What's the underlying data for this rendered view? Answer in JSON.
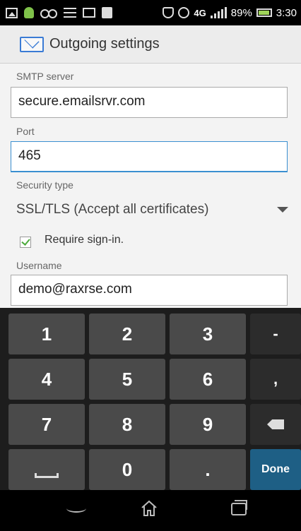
{
  "status_bar": {
    "battery": "89%",
    "time": "3:30",
    "icons": [
      "picture-icon",
      "android-icon",
      "voicemail-icon",
      "menu-lines-icon",
      "mail-icon",
      "shopping-bag-icon",
      "shield-icon",
      "clock-icon",
      "antenna-icon",
      "signal-icon",
      "battery-icon"
    ]
  },
  "action_bar": {
    "title": "Outgoing settings",
    "icon": "envelope-icon"
  },
  "form": {
    "smtp_label": "SMTP server",
    "smtp_value": "secure.emailsrvr.com",
    "port_label": "Port",
    "port_value": "465",
    "security_label": "Security type",
    "security_value": "SSL/TLS (Accept all certificates)",
    "require_signin_label": "Require sign-in.",
    "require_signin_checked": true,
    "username_label": "Username",
    "username_value": "demo@raxrse.com"
  },
  "keyboard": {
    "rows": [
      [
        "1",
        "2",
        "3",
        "-"
      ],
      [
        "4",
        "5",
        "6",
        ","
      ],
      [
        "7",
        "8",
        "9",
        "backspace"
      ],
      [
        "space",
        "0",
        ".",
        "Done"
      ]
    ],
    "done_label": "Done"
  },
  "nav_bar": {
    "icons": [
      "back-icon",
      "home-icon",
      "recent-apps-icon"
    ]
  }
}
